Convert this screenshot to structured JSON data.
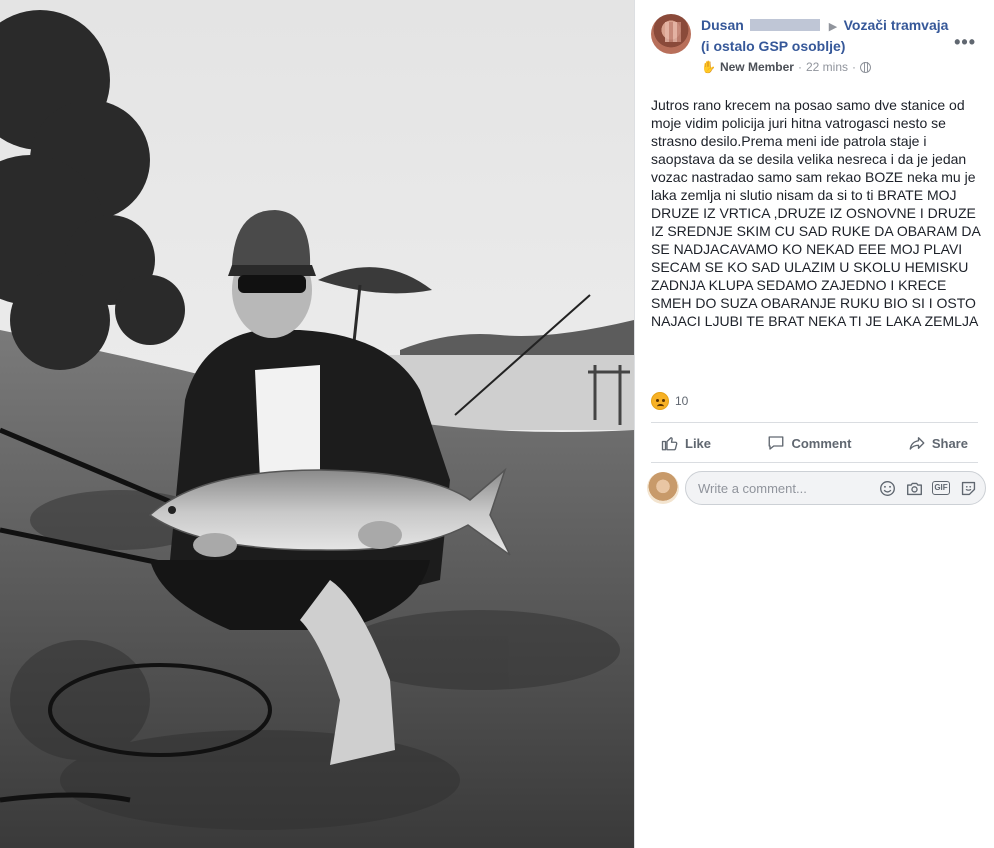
{
  "post": {
    "author": "Dusan",
    "group": "Vozači tramvaja",
    "group_line2": "(i ostalo GSP osoblje)",
    "badge": "New Member",
    "time": "22 mins",
    "separator": "·",
    "body": "Jutros rano krecem na posao samo dve stanice od moje vidim policija juri hitna vatrogasci nesto se strasno desilo.Prema meni ide patrola staje i saopstava da se desila velika nesreca i da je jedan vozac nastradao samo sam rekao BOZE neka mu je laka zemlja ni slutio nisam da si to ti BRATE MOJ DRUZE IZ VRTICA ,DRUZE IZ OSNOVNE I DRUZE IZ SREDNJE SKIM CU SAD RUKE DA OBARAM DA SE NADJACAVAMO KO NEKAD EEE MOJ PLAVI SECAM SE KO SAD ULAZIM U SKOLU HEMISKU ZADNJA KLUPA SEDAMO ZAJEDNO I KRECE SMEH DO SUZA OBARANJE RUKU BIO SI I OSTO NAJACI LJUBI TE BRAT NEKA TI JE LAKA ZEMLJA"
  },
  "reactions": {
    "count": "10",
    "icon": "sad-reaction-icon"
  },
  "actions": {
    "like": "Like",
    "comment": "Comment",
    "share": "Share"
  },
  "comment_input": {
    "placeholder": "Write a comment...",
    "value": ""
  },
  "colors": {
    "link": "#365899",
    "muted": "#90949c",
    "action": "#606770"
  }
}
